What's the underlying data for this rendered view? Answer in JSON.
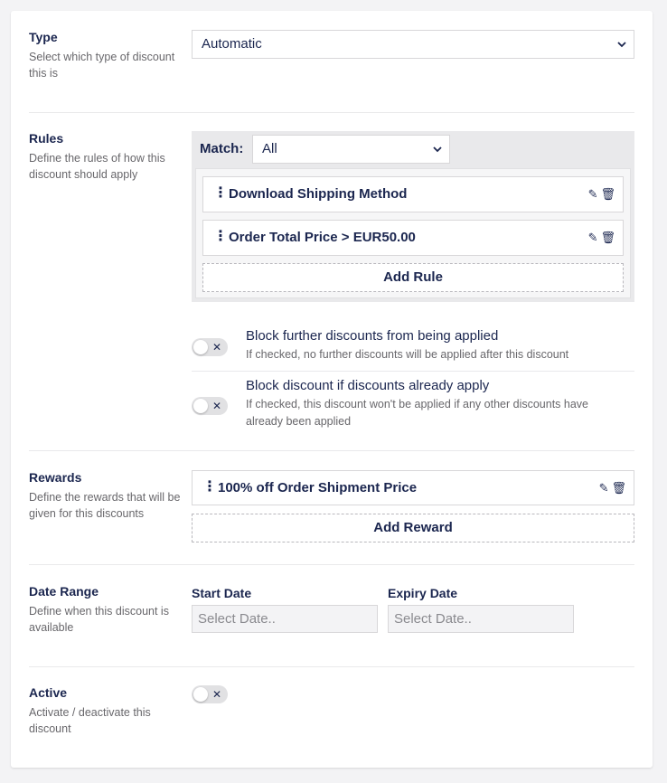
{
  "type_section": {
    "title": "Type",
    "desc": "Select which type of discount this is",
    "value": "Automatic"
  },
  "rules_section": {
    "title": "Rules",
    "desc": "Define the rules of how this discount should apply",
    "match_label": "Match:",
    "match_value": "All",
    "rules": [
      {
        "label": "Download Shipping Method"
      },
      {
        "label": "Order Total Price > EUR50.00"
      }
    ],
    "add_rule": "Add Rule",
    "block_further": {
      "title": "Block further discounts from being applied",
      "desc": "If checked, no further discounts will be applied after this discount"
    },
    "block_if_apply": {
      "title": "Block discount if discounts already apply",
      "desc": "If checked, this discount won't be applied if any other discounts have already been applied"
    }
  },
  "rewards_section": {
    "title": "Rewards",
    "desc": "Define the rewards that will be given for this discounts",
    "rewards": [
      {
        "label": "100% off Order Shipment Price"
      }
    ],
    "add_reward": "Add Reward"
  },
  "date_section": {
    "title": "Date Range",
    "desc": "Define when this discount is available",
    "start_label": "Start Date",
    "start_placeholder": "Select Date..",
    "expiry_label": "Expiry Date",
    "expiry_placeholder": "Select Date.."
  },
  "active_section": {
    "title": "Active",
    "desc": "Activate / deactivate this discount"
  },
  "icons": {
    "drag": "⋮",
    "edit": "✎",
    "delete": "🗑",
    "toggle_off": "✕",
    "chevron": "⌄"
  }
}
